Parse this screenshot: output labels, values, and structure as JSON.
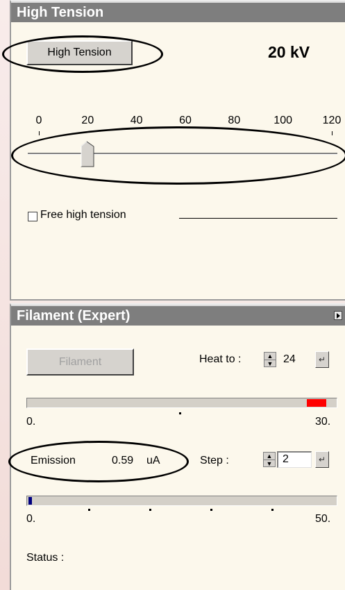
{
  "high_tension_panel": {
    "title": "High Tension",
    "button_label": "High Tension",
    "value_display": "20 kV",
    "scale_labels": [
      "0",
      "20",
      "40",
      "60",
      "80",
      "100",
      "120"
    ],
    "slider_value_kv": 20,
    "slider_max_kv": 120,
    "free_checkbox_label": "Free high tension",
    "free_checked": false
  },
  "filament_panel": {
    "title": "Filament (Expert)",
    "button_label": "Filament",
    "heat_label": "Heat to :",
    "heat_value": "24",
    "heat_bar": {
      "min_label": "0.",
      "max_label": "30.",
      "fill_fraction": 0.93,
      "fill_color": "#ff0000"
    },
    "emission_label": "Emission",
    "emission_value": "0.59",
    "emission_unit": "uA",
    "step_label": "Step :",
    "step_value": "2",
    "emission_bar": {
      "min_label": "0.",
      "max_label": "50.",
      "fill_fraction": 0.012,
      "fill_color": "#000080"
    },
    "status_label": "Status :"
  }
}
